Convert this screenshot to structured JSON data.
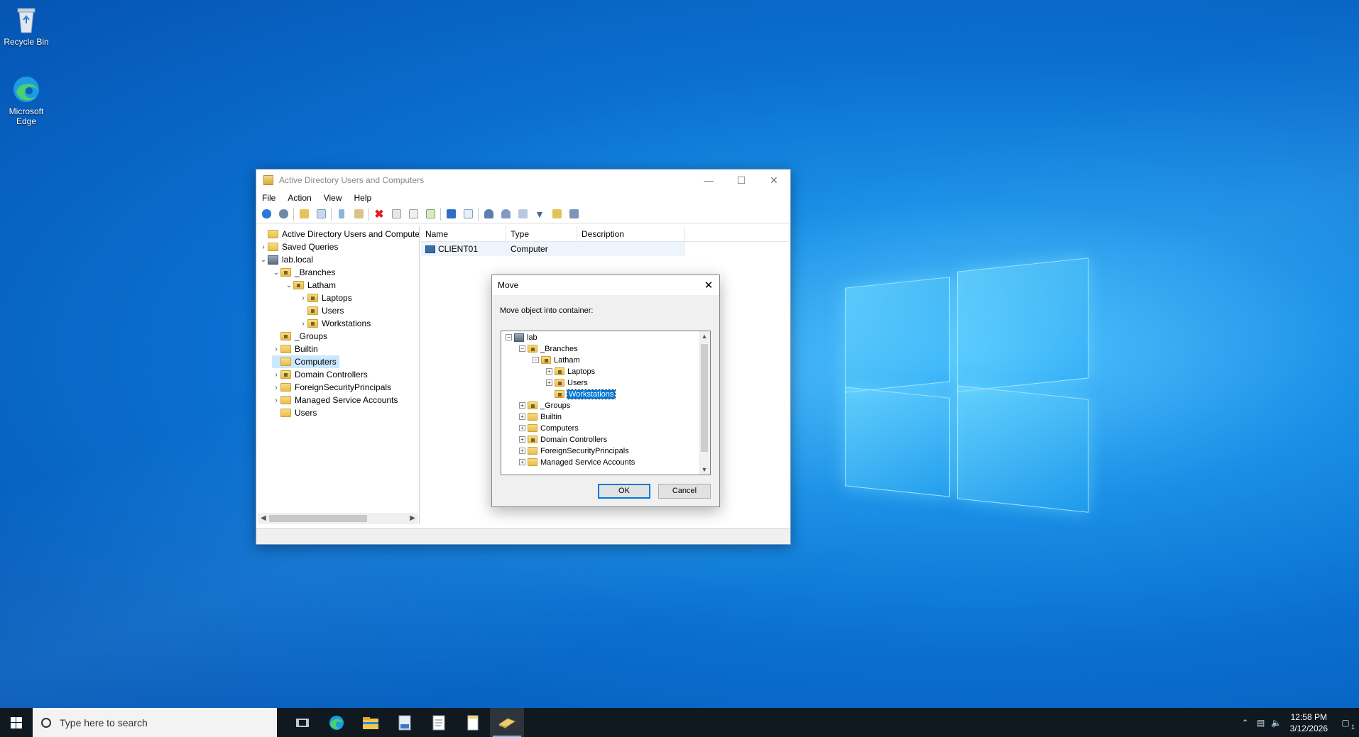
{
  "desktop": {
    "icons": [
      {
        "label": "Recycle Bin"
      },
      {
        "label": "Microsoft Edge"
      }
    ]
  },
  "window": {
    "title": "Active Directory Users and Computers",
    "menu": [
      "File",
      "Action",
      "View",
      "Help"
    ],
    "tree": {
      "root": "Active Directory Users and Computers",
      "saved_queries": "Saved Queries",
      "domain": "lab.local",
      "branches": "_Branches",
      "latham": "Latham",
      "laptops": "Laptops",
      "users_ou": "Users",
      "workstations": "Workstations",
      "groups": "_Groups",
      "builtin": "Builtin",
      "computers": "Computers",
      "domain_controllers": "Domain Controllers",
      "fsp": "ForeignSecurityPrincipals",
      "msa": "Managed Service Accounts",
      "users": "Users"
    },
    "list": {
      "columns": [
        "Name",
        "Type",
        "Description"
      ],
      "rows": [
        {
          "name": "CLIENT01",
          "type": "Computer",
          "description": ""
        }
      ]
    }
  },
  "dialog": {
    "title": "Move",
    "label": "Move object into container:",
    "tree": {
      "lab": "lab",
      "branches": "_Branches",
      "latham": "Latham",
      "laptops": "Laptops",
      "users_ou": "Users",
      "workstations": "Workstations",
      "groups": "_Groups",
      "builtin": "Builtin",
      "computers": "Computers",
      "domain_controllers": "Domain Controllers",
      "fsp": "ForeignSecurityPrincipals",
      "msa": "Managed Service Accounts"
    },
    "ok": "OK",
    "cancel": "Cancel"
  },
  "taskbar": {
    "search_placeholder": "Type here to search",
    "time": "12:58 PM",
    "date": "3/12/2026",
    "notification_count": "1"
  },
  "colors": {
    "accent": "#0078d7",
    "taskbar": "#101820",
    "selection": "#cce8ff"
  }
}
